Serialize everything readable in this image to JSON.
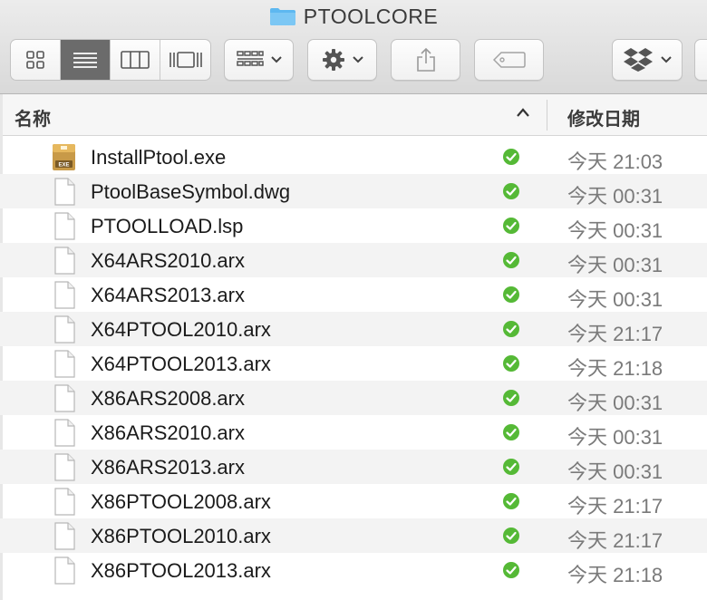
{
  "window": {
    "title": "PTOOLCORE"
  },
  "columns": {
    "name": "名称",
    "date_modified": "修改日期"
  },
  "files": [
    {
      "name": "InstallPtool.exe",
      "date": "今天 21:03",
      "icon": "exe-icon"
    },
    {
      "name": "PtoolBaseSymbol.dwg",
      "date": "今天 00:31",
      "icon": "document-icon"
    },
    {
      "name": "PTOOLLOAD.lsp",
      "date": "今天 00:31",
      "icon": "document-icon"
    },
    {
      "name": "X64ARS2010.arx",
      "date": "今天 00:31",
      "icon": "document-icon"
    },
    {
      "name": "X64ARS2013.arx",
      "date": "今天 00:31",
      "icon": "document-icon"
    },
    {
      "name": "X64PTOOL2010.arx",
      "date": "今天 21:17",
      "icon": "document-icon"
    },
    {
      "name": "X64PTOOL2013.arx",
      "date": "今天 21:18",
      "icon": "document-icon"
    },
    {
      "name": "X86ARS2008.arx",
      "date": "今天 00:31",
      "icon": "document-icon"
    },
    {
      "name": "X86ARS2010.arx",
      "date": "今天 00:31",
      "icon": "document-icon"
    },
    {
      "name": "X86ARS2013.arx",
      "date": "今天 00:31",
      "icon": "document-icon"
    },
    {
      "name": "X86PTOOL2008.arx",
      "date": "今天 21:17",
      "icon": "document-icon"
    },
    {
      "name": "X86PTOOL2010.arx",
      "date": "今天 21:17",
      "icon": "document-icon"
    },
    {
      "name": "X86PTOOL2013.arx",
      "date": "今天 21:18",
      "icon": "document-icon"
    }
  ],
  "colors": {
    "sync_check": "#55b936",
    "folder_blue": "#5db8f0",
    "active_view": "#6b6b6b"
  }
}
